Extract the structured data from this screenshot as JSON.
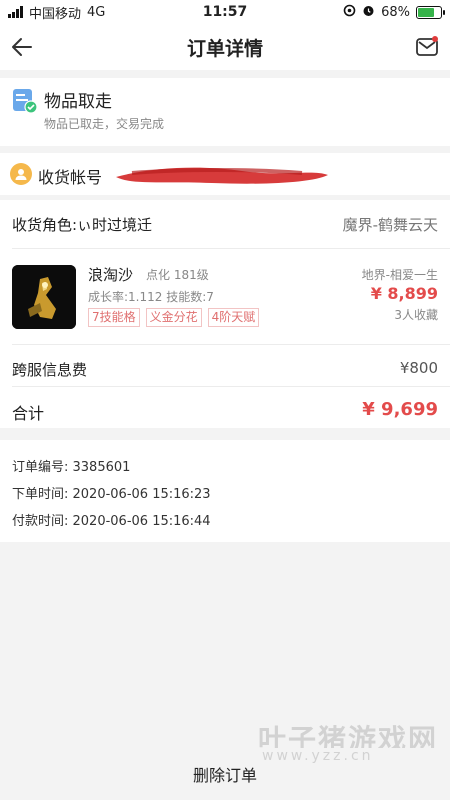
{
  "status_bar": {
    "carrier": "中国移动",
    "network": "4G",
    "time": "11:57",
    "battery_percent": "68%",
    "battery_level": 0.68,
    "icons": [
      "signal-icon",
      "location-lock-icon",
      "alarm-icon",
      "battery-charging-icon"
    ]
  },
  "header": {
    "title": "订单详情",
    "back_icon": "arrow-left-icon",
    "message_icon": "mail-icon",
    "notification_color": "#e03b3b"
  },
  "order_status": {
    "icon": "document-check-icon",
    "title": "物品取走",
    "subtitle": "物品已取走，交易完成"
  },
  "receiving_account": {
    "icon": "user-avatar-icon",
    "label": "收货帐号"
  },
  "role": {
    "label": "收货角色:ぃ时过境迁",
    "server": "魔界-鹤舞云天"
  },
  "item": {
    "name": "浪淘沙",
    "level": "点化 181级",
    "stats": "成长率:1.112  技能数:7",
    "tags": [
      "7技能格",
      "义金分花",
      "4阶天赋"
    ],
    "server": "地界-相爱一生",
    "price": "¥ 8,899",
    "favorites": "3人收藏"
  },
  "fees": {
    "cross_server_label": "跨服信息费",
    "cross_server_value": "¥800",
    "total_label": "合计",
    "total_value": "¥ 9,699"
  },
  "order_info": {
    "order_number": "订单编号: 3385601",
    "order_time": "下单时间:  2020-06-06 15:16:23",
    "payment_time": "付款时间:  2020-06-06 15:16:44"
  },
  "watermark": {
    "text": "叶子猪游戏网",
    "url": "www.yzz.cn"
  },
  "actions": {
    "delete_label": "删除订单"
  },
  "colors": {
    "price_red": "#e34b4b",
    "tag_red": "#e07070",
    "accent_blue": "#4a90e2",
    "check_green": "#3cc47c"
  }
}
